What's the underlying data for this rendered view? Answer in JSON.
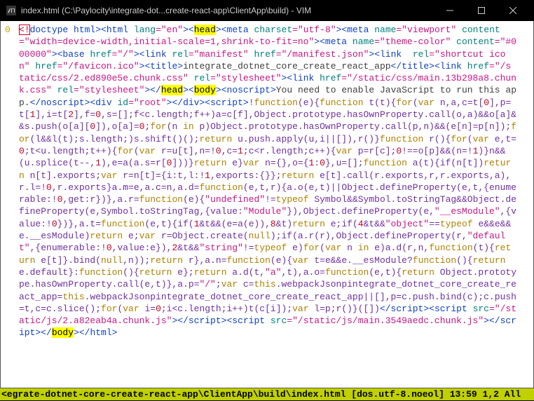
{
  "window": {
    "title": "index.html (C:\\Paylocity\\integrate-dot...create-react-app\\ClientApp\\build) - VIM",
    "minimize_icon": "minimize",
    "maximize_icon": "maximize",
    "close_icon": "close"
  },
  "gutter": {
    "line_number": "0"
  },
  "code": {
    "doctype_open": "<!",
    "doctype_word": "doctype html",
    "tag_html_open": "><",
    "tag_html": "html",
    "attr_lang": " lang",
    "val_en": "=\"en\"",
    "head_open": "><",
    "head": "head",
    "meta1": "><",
    "tag_meta": "meta",
    "attr_charset": " charset",
    "val_utf8": "=\"utf-8\"",
    "meta2": "><",
    "attr_name": " name",
    "val_viewport": "=\"viewport\"",
    "attr_content": "content",
    "val_viewport_content": "=\"width=device-width,initial-scale=1,shrink-to-fit=no\"",
    "meta3": "><",
    "val_themecolor": "=\"theme-color\"",
    "val_black": "=\"#000000\"",
    "base": "><",
    "tag_base": "base",
    "attr_href": " href",
    "val_slash": "=\"/\"",
    "link1": "><",
    "tag_link": "link",
    "attr_rel": " rel",
    "val_manifest": "=\"manifest\"",
    "val_manifestjson": "=\"/manifest.json\"",
    "link2": "><",
    "val_shortcut": "=\"shortcut icon\"",
    "val_favicon": "=\"/favicon.ico\"",
    "title_open": "><",
    "tag_title": "title",
    "title_close_open": ">",
    "title_text": "integrate_dotnet_core_create_react_app",
    "title_end": "</",
    "link3": "><",
    "val_css1": "=\"/static/css/2.ed890e5e.chunk.css\"",
    "val_stylesheet": "=\"stylesheet\"",
    "link4": "><",
    "val_css2": "=\"/static/css/main.13b298a8.chunk.css\"",
    "head_close": "></",
    "body_open": "><",
    "tag_body": "body",
    "noscript_open": "><",
    "tag_noscript": "noscript",
    "noscript_gt": ">",
    "noscript_text": "You need to enable JavaScript to run this app.",
    "noscript_close": "</",
    "div_open": "><",
    "tag_div": "div",
    "attr_id": " id",
    "val_root": "=\"root\"",
    "div_close": "></",
    "script_open": "><",
    "tag_script": "script",
    "script_gt": ">",
    "js_body": "!function(e){function t(t){for(var n,a,c=t[0],p=t[1],i=t[2],f=0,s=[];f<c.length;f++)a=c[f],Object.prototype.hasOwnProperty.call(o,a)&&o[a]&&s.push(o[a][0]),o[a]=0;for(n in p)Object.prototype.hasOwnProperty.call(p,n)&&(e[n]=p[n]);for(l&&l(t);s.length;)s.shift()();return u.push.apply(u,i||[]),r()}function r(){for(var e,t=0;t<u.length;t++){for(var r=u[t],n=!0,c=1;c<r.length;c++){var p=r[c];0!==o[p]&&(n=!1)}n&&(u.splice(t--,1),e=a(a.s=r[0]))}return e}var n={},o={1:0},u=[];function a(t){if(n[t])return n[t].exports;var r=n[t]={i:t,l:!1,exports:{}};return e[t].call(r.exports,r,r.exports,a),r.l=!0,r.exports}a.m=e,a.c=n,a.d=function(e,t,r){a.o(e,t)||Object.defineProperty(e,t,{enumerable:!0,get:r})},a.r=function(e){\"undefined\"!=typeof Symbol&&Symbol.toStringTag&&Object.defineProperty(e,Symbol.toStringTag,{value:\"Module\"}),Object.defineProperty(e,\"__esModule\",{value:!0})},a.t=function(e,t){if(1&t&&(e=a(e)),8&t)return e;if(4&t&&\"object\"==typeof e&&e&&e.__esModule)return e;var r=Object.create(null);if(a.r(r),Object.defineProperty(r,\"default\",{enumerable:!0,value:e}),2&t&&\"string\"!=typeof e)for(var n in e)a.d(r,n,function(t){return e[t]}.bind(null,n));return r},a.n=function(e){var t=e&&e.__esModule?function(){return e.default}:function(){return e};return a.d(t,\"a\",t),a.o=function(e,t){return Object.prototype.hasOwnProperty.call(e,t)},a.p=\"/\";var c=this.webpackJsonpintegrate_dotnet_core_create_react_app=this.webpackJsonpintegrate_dotnet_core_create_react_app||[],p=c.push.bind(c);c.push=t,c=c.slice();for(var i=0;i<c.length;i++)t(c[i]);var l=p;r()}([])",
    "script_close": "</",
    "script2_open": "><",
    "attr_src": " src",
    "val_js1": "=\"/static/js/2.a82eab4a.chunk.js\"",
    "script2_close": "></",
    "script3_open": "><",
    "val_js2": "=\"/static/js/main.3549aedc.chunk.js\"",
    "script3_close": "></",
    "body_close": "></",
    "html_close": "></",
    "final_gt": ">"
  },
  "statusline": {
    "left": "<egrate-dotnet-core-create-react-app\\ClientApp\\build\\index.html [dos.utf-8.noeol] 13:59 1,2 All"
  }
}
